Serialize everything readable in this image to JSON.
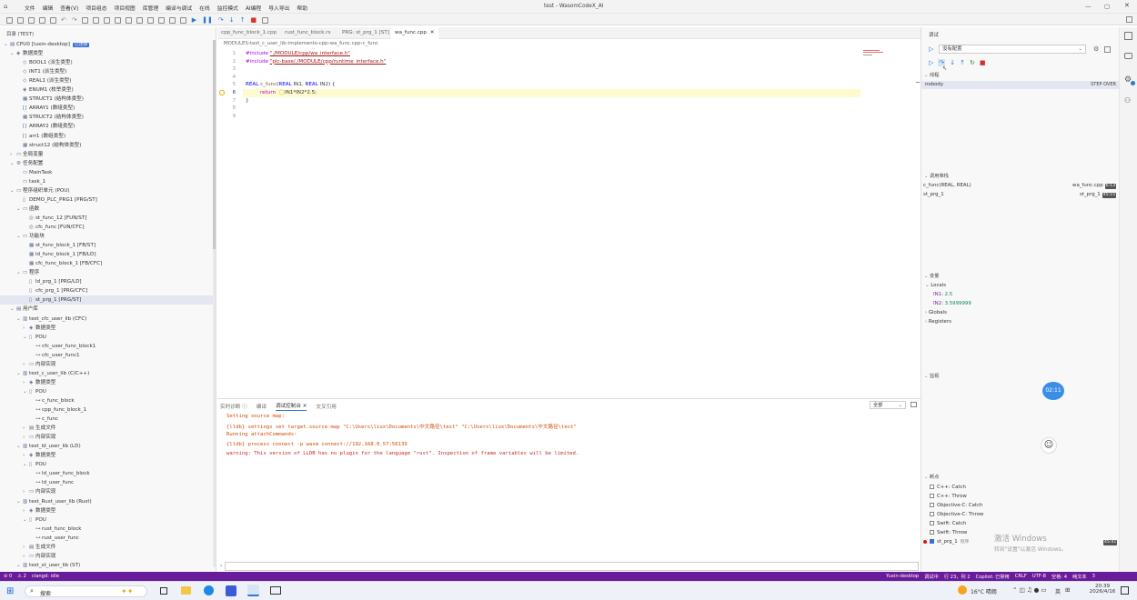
{
  "window": {
    "title": "test - WasomCodeX_AI"
  },
  "menu": [
    "文件",
    "编辑",
    "查看(V)",
    "项目组态",
    "项目视图",
    "库管理",
    "编译与调试",
    "在线",
    "监控模式",
    "AI编程",
    "导入导出",
    "帮助"
  ],
  "explorer": {
    "header": "目录 (TEST)",
    "items": [
      {
        "t": "CPU0 [luxin-desktop]",
        "badge": "已连接",
        "d": 0,
        "tw": "⌄",
        "ic": "▤"
      },
      {
        "t": "数据类型",
        "d": 1,
        "tw": "⌄",
        "ic": "◈"
      },
      {
        "t": "BOOL1 (派生类型)",
        "d": 2,
        "tw": "",
        "ic": "◇"
      },
      {
        "t": "INT1 (派生类型)",
        "d": 2,
        "tw": "",
        "ic": "◇"
      },
      {
        "t": "REAL1 (派生类型)",
        "d": 2,
        "tw": "",
        "ic": "◇"
      },
      {
        "t": "ENUM1 (枚举类型)",
        "d": 2,
        "tw": "",
        "ic": "◈"
      },
      {
        "t": "STRUCT1 (结构体类型)",
        "d": 2,
        "tw": "",
        "ic": "▦"
      },
      {
        "t": "ARRAY1 (数组类型)",
        "d": 2,
        "tw": "",
        "ic": "[]"
      },
      {
        "t": "STRUCT2 (结构体类型)",
        "d": 2,
        "tw": "",
        "ic": "▦"
      },
      {
        "t": "ARRAY2 (数组类型)",
        "d": 2,
        "tw": "",
        "ic": "[]"
      },
      {
        "t": "arr1 (数组类型)",
        "d": 2,
        "tw": "",
        "ic": "[]"
      },
      {
        "t": "struct12 (结构体类型)",
        "d": 2,
        "tw": "",
        "ic": "▦"
      },
      {
        "t": "全局变量",
        "d": 1,
        "tw": "›",
        "ic": "▭"
      },
      {
        "t": "任务配置",
        "d": 1,
        "tw": "⌄",
        "ic": "⚙"
      },
      {
        "t": "MainTask",
        "d": 2,
        "tw": "",
        "ic": "▭"
      },
      {
        "t": "task_1",
        "d": 2,
        "tw": "",
        "ic": "▭"
      },
      {
        "t": "程序组织单元 (POU)",
        "d": 1,
        "tw": "⌄",
        "ic": "▭"
      },
      {
        "t": "DEMO_PLC_PRG1 [PRG/ST]",
        "d": 2,
        "tw": "",
        "ic": "▯"
      },
      {
        "t": "函数",
        "d": 2,
        "tw": "⌄",
        "ic": "▭"
      },
      {
        "t": "st_func_12 [FUN/ST]",
        "d": 3,
        "tw": "",
        "ic": "◎"
      },
      {
        "t": "cfc_func [FUN/CFC]",
        "d": 3,
        "tw": "",
        "ic": "◎"
      },
      {
        "t": "功能块",
        "d": 2,
        "tw": "⌄",
        "ic": "▭"
      },
      {
        "t": "st_func_block_1 [FB/ST]",
        "d": 3,
        "tw": "",
        "ic": "▦"
      },
      {
        "t": "ld_func_block_1 [FB/LD]",
        "d": 3,
        "tw": "",
        "ic": "▦"
      },
      {
        "t": "cfc_func_block_1 [FB/CFC]",
        "d": 3,
        "tw": "",
        "ic": "▦"
      },
      {
        "t": "程序",
        "d": 2,
        "tw": "⌄",
        "ic": "▭"
      },
      {
        "t": "ld_prg_1 [PRG/LD]",
        "d": 3,
        "tw": "",
        "ic": "▯"
      },
      {
        "t": "cfc_prg_1 [PRG/CFC]",
        "d": 3,
        "tw": "",
        "ic": "▯"
      },
      {
        "t": "st_prg_1 [PRG/ST]",
        "d": 3,
        "tw": "",
        "ic": "▯",
        "sel": true
      },
      {
        "t": "用户库",
        "d": 1,
        "tw": "⌄",
        "ic": "▤"
      },
      {
        "t": "test_cfc_user_lib (CFC)",
        "d": 2,
        "tw": "⌄",
        "ic": "▥"
      },
      {
        "t": "数据类型",
        "d": 3,
        "tw": "›",
        "ic": "◈"
      },
      {
        "t": "POU",
        "d": 3,
        "tw": "⌄",
        "ic": "▯"
      },
      {
        "t": "cfc_user_func_block1",
        "d": 4,
        "tw": "",
        "ic": "⊶"
      },
      {
        "t": "cfc_user_func1",
        "d": 4,
        "tw": "",
        "ic": "⊶"
      },
      {
        "t": "内部实现",
        "d": 3,
        "tw": "›",
        "ic": "▭"
      },
      {
        "t": "test_c_user_lib (C/C++)",
        "d": 2,
        "tw": "⌄",
        "ic": "▥"
      },
      {
        "t": "数据类型",
        "d": 3,
        "tw": "›",
        "ic": "◈"
      },
      {
        "t": "POU",
        "d": 3,
        "tw": "⌄",
        "ic": "▯"
      },
      {
        "t": "c_func_block",
        "d": 4,
        "tw": "",
        "ic": "⊶"
      },
      {
        "t": "cpp_func_block_1",
        "d": 4,
        "tw": "",
        "ic": "⊶"
      },
      {
        "t": "c_func",
        "d": 4,
        "tw": "",
        "ic": "⊶"
      },
      {
        "t": "生成文件",
        "d": 3,
        "tw": "›",
        "ic": "▤"
      },
      {
        "t": "内部实现",
        "d": 3,
        "tw": "›",
        "ic": "▭"
      },
      {
        "t": "test_ld_user_lib (LD)",
        "d": 2,
        "tw": "⌄",
        "ic": "▥"
      },
      {
        "t": "数据类型",
        "d": 3,
        "tw": "›",
        "ic": "◈"
      },
      {
        "t": "POU",
        "d": 3,
        "tw": "⌄",
        "ic": "▯"
      },
      {
        "t": "ld_user_func_block",
        "d": 4,
        "tw": "",
        "ic": "⊶"
      },
      {
        "t": "ld_user_func",
        "d": 4,
        "tw": "",
        "ic": "⊶"
      },
      {
        "t": "内部实现",
        "d": 3,
        "tw": "›",
        "ic": "▭"
      },
      {
        "t": "test_Rust_user_lib (Rust)",
        "d": 2,
        "tw": "⌄",
        "ic": "▥"
      },
      {
        "t": "数据类型",
        "d": 3,
        "tw": "›",
        "ic": "◈"
      },
      {
        "t": "POU",
        "d": 3,
        "tw": "⌄",
        "ic": "▯"
      },
      {
        "t": "rust_func_block",
        "d": 4,
        "tw": "",
        "ic": "⊶"
      },
      {
        "t": "rust_user_func",
        "d": 4,
        "tw": "",
        "ic": "⊶"
      },
      {
        "t": "生成文件",
        "d": 3,
        "tw": "›",
        "ic": "▤"
      },
      {
        "t": "内部实现",
        "d": 3,
        "tw": "›",
        "ic": "▭"
      },
      {
        "t": "test_st_user_lib (ST)",
        "d": 2,
        "tw": "⌄",
        "ic": "▥"
      }
    ]
  },
  "tabs": [
    {
      "label": "cpp_func_block_1.cpp",
      "active": false
    },
    {
      "label": "rust_func_block.rs",
      "active": false
    },
    {
      "label": "PRG: st_prg_1 [ST]",
      "active": false
    },
    {
      "label": "wa_func.cpp",
      "active": true,
      "close": "✕"
    }
  ],
  "breadcrumb": [
    "MODULES",
    "test_c_user_lib",
    "implements",
    "cpp",
    "wa_func.cpp",
    "c_func"
  ],
  "code": {
    "line_numbers": [
      "1",
      "2",
      "3",
      "4",
      "5",
      "6",
      "7",
      "8",
      "9"
    ],
    "inc1_kw": "#include",
    "inc1_str": "\"./MODULE/cpp/wa_interface.h\"",
    "inc2_kw": "#include",
    "inc2_str": "\"plc-base/./MODULE/cpp/runtime_interface.h\"",
    "l5_type1": "REAL",
    "l5_fn": "c_func",
    "l5_p1": "(",
    "l5_type2": "REAL",
    "l5_a1": " IN1, ",
    "l5_type3": "REAL",
    "l5_a2": " IN2) {",
    "l6_ret": "return",
    "l6_expr": "IN1*IN2*2.5;",
    "l7": "}"
  },
  "panel": {
    "tabs": [
      "实时诊断",
      "编译",
      "调试控制台",
      "交叉引用"
    ],
    "active_tab": 2,
    "filter": "全部",
    "lines": [
      {
        "c": "#d04a02",
        "t": "Setting source map:"
      },
      {
        "c": "#d04a02",
        "t": "{lldb} settings set target.source-map \"C:\\Users\\liux\\Documents\\中文路径\\test\" \"C:\\Users\\liux\\Documents\\中文路径\\test\""
      },
      {
        "c": "#d04a02",
        "t": "Running attachCommands:"
      },
      {
        "c": "#d04a02",
        "t": "{lldb} process connect -p wasm connect://192.168.0.57:56139"
      },
      {
        "c": "#c62828",
        "t": "warning: This version of LLDB has no plugin for the language \"rust\". Inspection of frame variables will be limited."
      }
    ],
    "prompt": "›"
  },
  "debug": {
    "header": "调试",
    "config": "没有配置",
    "threads_title": "线程",
    "thread_name": "nobody",
    "thread_state": "STEP OVER",
    "callstack_title": "调用堆栈",
    "frames": [
      {
        "fn": "c_func(REAL, REAL)",
        "file": "wa_func.cpp",
        "line": "6:13"
      },
      {
        "fn": "st_prg_1",
        "file": "st_prg_1",
        "line": "45:15"
      }
    ],
    "vars_title": "变量",
    "locals": "Locals",
    "vars": [
      {
        "n": "IN1",
        "v": "2.5"
      },
      {
        "n": "IN2",
        "v": "3.5999999"
      }
    ],
    "globals": "Globals",
    "registers": "Registers",
    "watch_title": "监视",
    "timer": "02:11",
    "bp_title": "断点",
    "breakpoints": [
      {
        "t": "C++: Catch",
        "on": false
      },
      {
        "t": "C++: Throw",
        "on": false
      },
      {
        "t": "Objective-C: Catch",
        "on": false
      },
      {
        "t": "Objective-C: Throw",
        "on": false
      },
      {
        "t": "Swift: Catch",
        "on": false
      },
      {
        "t": "Swift: Throw",
        "on": false
      },
      {
        "t": "st_prg_1",
        "on": true,
        "sub": "程序",
        "line": "45:41"
      }
    ],
    "watermark1": "激活 Windows",
    "watermark2": "转到\"设置\"以激活 Windows。"
  },
  "status": {
    "left": [
      "⊘ 0",
      "⚠ 2",
      "clangd: idle"
    ],
    "right": [
      "Yuxin-desktop",
      "调试中",
      "行 23，列 2",
      "Copilot: 已禁用",
      "CRLF",
      "UTF-8",
      "空格: 4",
      "纯文本",
      "3"
    ]
  },
  "taskbar": {
    "search": "搜索",
    "weather": "16°C 晴朗",
    "ime": "英",
    "time": "20:39",
    "date": "2026/4/16"
  }
}
